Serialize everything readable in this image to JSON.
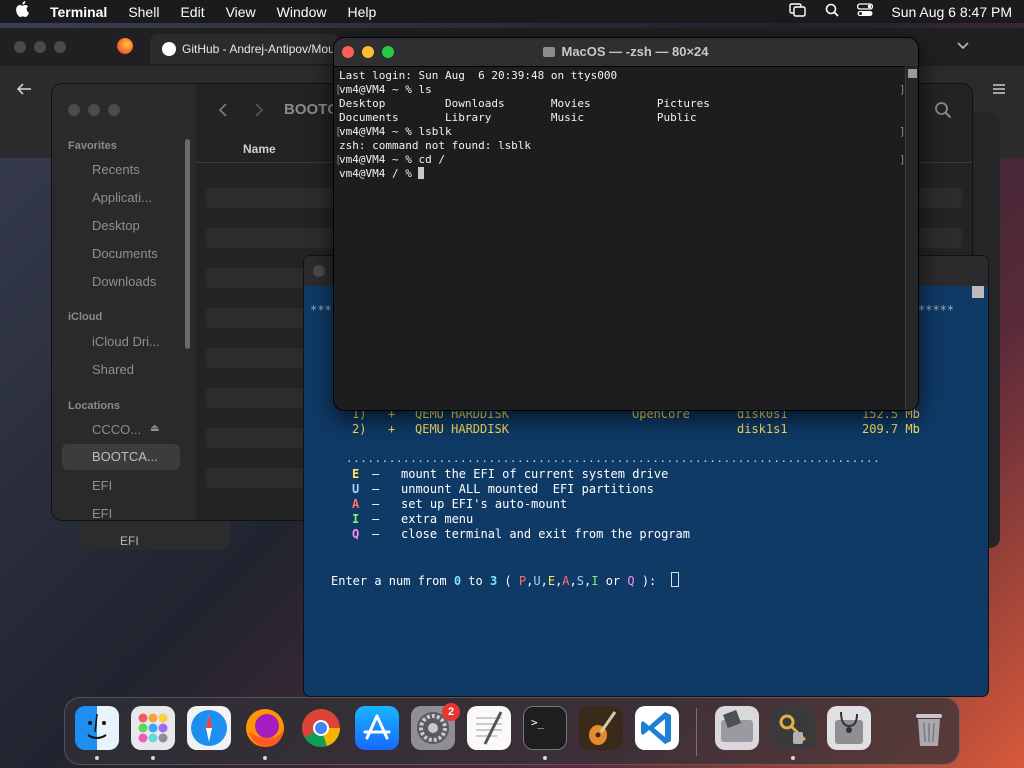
{
  "menubar": {
    "app": "Terminal",
    "items": [
      "Shell",
      "Edit",
      "View",
      "Window",
      "Help"
    ],
    "clock": "Sun Aug 6  8:47 PM"
  },
  "browser": {
    "tab_title": "GitHub - Andrej-Antipov/Mou"
  },
  "finder": {
    "toolbar_title": "BOOTC",
    "column_name": "Name",
    "favorites_header": "Favorites",
    "favorites": [
      "Recents",
      "Applicati...",
      "Desktop",
      "Documents",
      "Downloads"
    ],
    "icloud_header": "iCloud",
    "icloud": [
      "iCloud Dri...",
      "Shared"
    ],
    "locations_header": "Locations",
    "locations": [
      "CCCO...",
      "BOOTCA...",
      "EFI",
      "EFI"
    ],
    "behind_label": "EFI"
  },
  "efi_tool": {
    "stars_left": "***",
    "stars_right": "*****",
    "disks": [
      {
        "num": "1)",
        "mark": "+",
        "name": "QEMU HARDDISK",
        "type": "OpenCore",
        "id": "disk0s1",
        "size": "152.5 Mb"
      },
      {
        "num": "2)",
        "mark": "+",
        "name": "QEMU HARDDISK",
        "type": "",
        "id": "disk1s1",
        "size": "209.7 Mb"
      }
    ],
    "divider": "...........................................................................",
    "menu": [
      {
        "key": "E",
        "desc": "mount the EFI of current system drive",
        "color": "#ffe45c"
      },
      {
        "key": "U",
        "desc": "unmount ALL mounted  EFI partitions",
        "color": "#9fd4ff"
      },
      {
        "key": "A",
        "desc": "set up EFI's auto-mount",
        "color": "#ff7070"
      },
      {
        "key": "I",
        "desc": "extra menu",
        "color": "#7df07d"
      },
      {
        "key": "Q",
        "desc": "close terminal and exit from the program",
        "color": "#ff8cf0"
      }
    ],
    "prompt": {
      "p1": "Enter a num from ",
      "n0": "0",
      "p2": " to ",
      "n3": "3",
      "p3": " ( ",
      "letters": [
        {
          "t": "P",
          "color": "#ff7070"
        },
        {
          "t": "U",
          "color": "#9fd4ff"
        },
        {
          "t": "E",
          "color": "#ffe45c"
        },
        {
          "t": "A",
          "color": "#ff7070"
        },
        {
          "t": "S",
          "color": "#9fd4ff"
        },
        {
          "t": "I",
          "color": "#7df07d"
        }
      ],
      "or": " or ",
      "q": "Q",
      "end": " ):  "
    }
  },
  "terminal": {
    "title": "MacOS — -zsh — 80×24",
    "lines": [
      "Last login: Sun Aug  6 20:39:48 on ttys000",
      "vm4@VM4 ~ % ls",
      "Desktop         Downloads       Movies          Pictures",
      "Documents       Library         Music           Public",
      "vm4@VM4 ~ % lsblk",
      "zsh: command not found: lsblk",
      "vm4@VM4 ~ % cd /"
    ],
    "prompt": "vm4@VM4 / % "
  },
  "dock": {
    "settings_badge": "2"
  },
  "colors": {
    "terminal_bg": "#1d1d1f",
    "efi_bg": "#0f3a66",
    "number_color": "#7fe3ff"
  }
}
